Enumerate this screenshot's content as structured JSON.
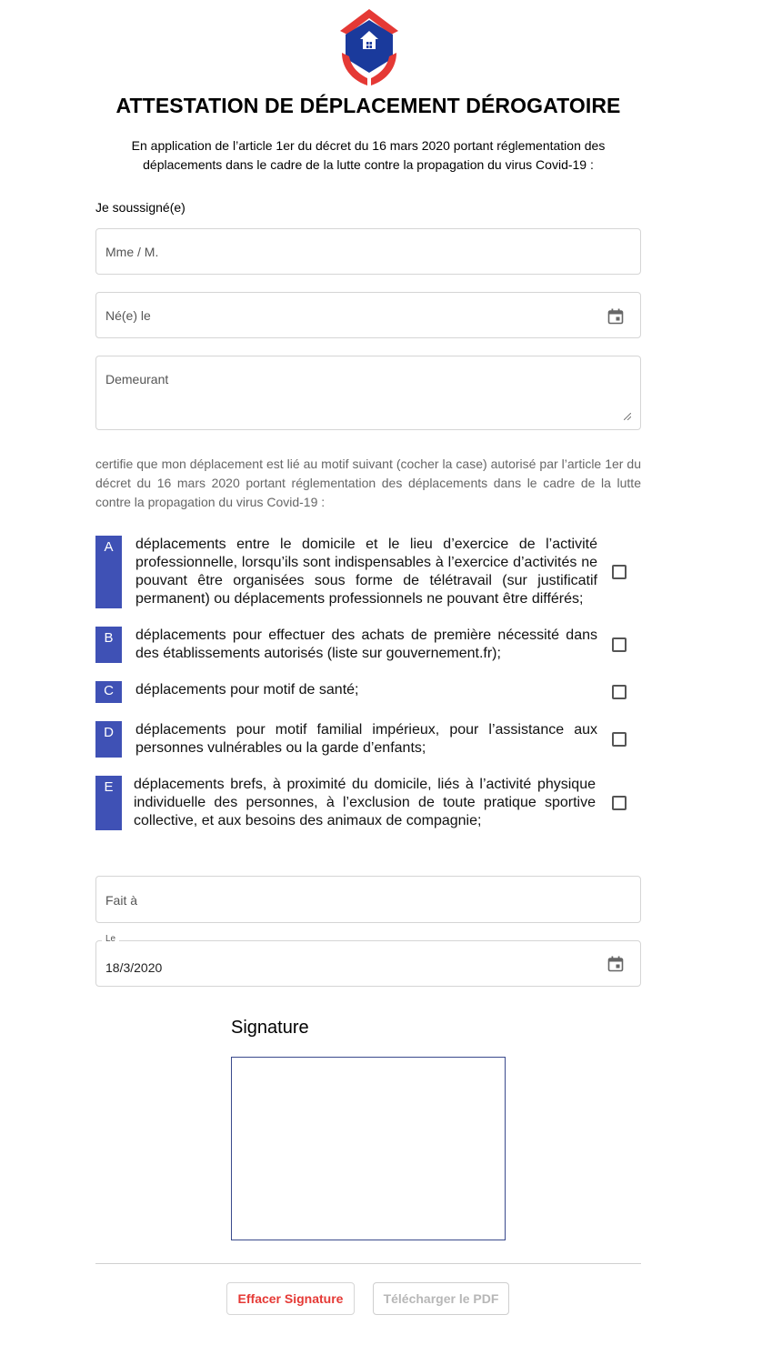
{
  "header": {
    "title": "ATTESTATION DE DÉPLACEMENT DÉROGATOIRE",
    "intro_line1": "En application de l’article 1er du décret du 16 mars 2020 portant réglementation des",
    "intro_line2": "déplacements dans le cadre de la lutte contre la propagation du virus Covid-19 :"
  },
  "form": {
    "soussigne_label": "Je soussigné(e)",
    "name_placeholder": "Mme / M.",
    "birth_placeholder": "Né(e) le",
    "address_placeholder": "Demeurant",
    "certifie_text": "certifie que mon déplacement est lié au motif suivant (cocher la case) autorisé par l’article 1er du décret du 16 mars 2020 portant réglementation des déplacements dans le cadre de la lutte contre la propagation du virus Covid-19 :",
    "motifs": [
      {
        "letter": "A",
        "text": "déplacements entre le domicile et le lieu d’exercice de l’activité professionnelle, lorsqu’ils sont indispensables à l’exercice d’activités ne pouvant être organisées sous forme de télétravail (sur justificatif permanent) ou déplacements professionnels ne pouvant être différés;",
        "checked": false
      },
      {
        "letter": "B",
        "text": "déplacements pour effectuer des achats de première nécessité dans des établissements autorisés (liste sur gouvernement.fr);",
        "checked": false
      },
      {
        "letter": "C",
        "text": "déplacements pour motif de santé;",
        "checked": false
      },
      {
        "letter": "D",
        "text": "déplacements pour motif familial impérieux, pour l’assistance aux personnes vulnérables ou la garde d’enfants;",
        "checked": false
      },
      {
        "letter": "E",
        "text": "déplacements brefs, à proximité du domicile, liés à l’activité physique individuelle des personnes, à l’exclusion de toute pratique sportive collective, et aux besoins des animaux de compagnie;",
        "checked": false
      }
    ],
    "fait_a_placeholder": "Fait à",
    "date_label": "Le",
    "date_value": "18/3/2020"
  },
  "signature": {
    "title": "Signature",
    "clear_label": "Effacer Signature",
    "download_label": "Télécharger le PDF"
  },
  "colors": {
    "accent": "#3f51b5",
    "logo_red": "#e53935",
    "logo_blue": "#1a3a9c",
    "danger_text": "#e53935"
  },
  "icons": {
    "logo": "house-in-hands-logo",
    "calendar": "calendar-icon",
    "resize": "resize-handle-icon"
  }
}
